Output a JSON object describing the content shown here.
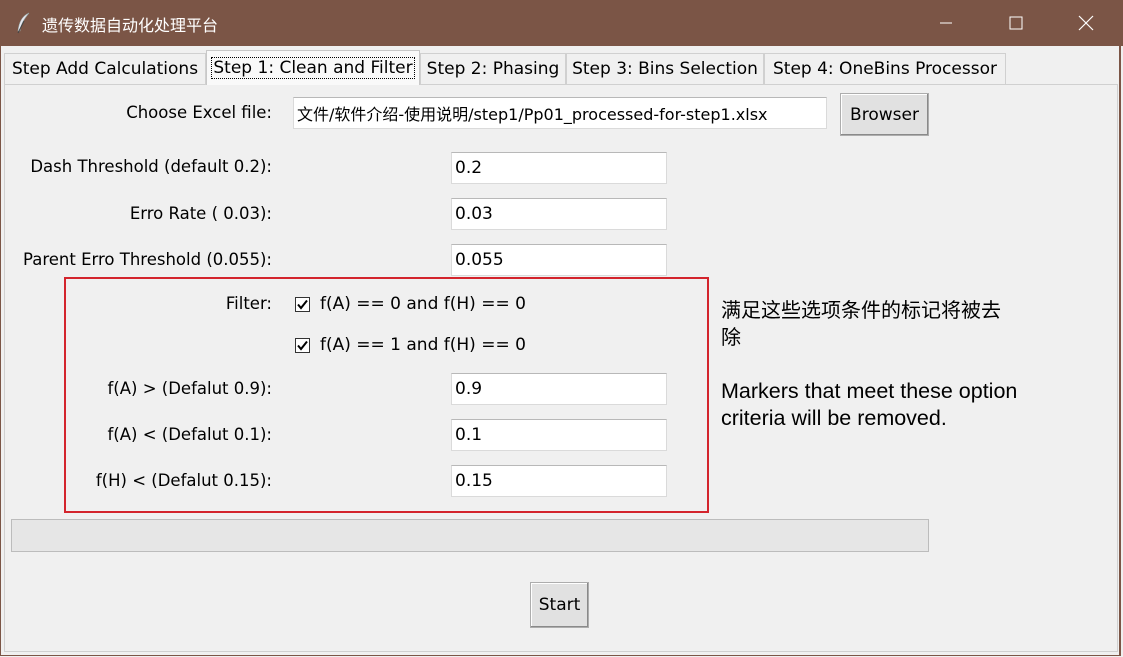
{
  "window": {
    "title": "遗传数据自动化处理平台",
    "icon": "feather-icon",
    "controls": [
      "minimize-icon",
      "maximize-icon",
      "close-icon"
    ]
  },
  "tabs": [
    {
      "label": "Step Add Calculations",
      "active": false
    },
    {
      "label": "Step 1: Clean and Filter",
      "active": true
    },
    {
      "label": "Step 2: Phasing",
      "active": false
    },
    {
      "label": "Step 3: Bins Selection",
      "active": false
    },
    {
      "label": "Step 4: OneBins Processor",
      "active": false
    }
  ],
  "file": {
    "label": "Choose Excel file:",
    "value": "文件/软件介绍-使用说明/step1/Pp01_processed-for-step1.xlsx",
    "browse_label": "Browser"
  },
  "fields": {
    "dash_threshold": {
      "label": "Dash Threshold (default 0.2):",
      "value": "0.2"
    },
    "erro_rate": {
      "label": "Erro Rate ( 0.03):",
      "value": "0.03"
    },
    "parent_erro": {
      "label": "Parent Erro Threshold (0.055):",
      "value": "0.055"
    },
    "fa_gt": {
      "label": "f(A) > (Defalut 0.9):",
      "value": "0.9"
    },
    "fa_lt": {
      "label": "f(A) < (Defalut 0.1):",
      "value": "0.1"
    },
    "fh_lt": {
      "label": "f(H) < (Defalut 0.15):",
      "value": "0.15"
    }
  },
  "filter": {
    "label": "Filter:",
    "options": [
      {
        "label": "f(A) == 0 and f(H) == 0",
        "checked": true
      },
      {
        "label": "f(A) == 1 and f(H) == 0",
        "checked": true
      }
    ]
  },
  "note": {
    "cn_line1": "满足这些选项条件的标记将被去",
    "cn_line2": "除",
    "en_line1": "Markers that meet these option",
    "en_line2": "criteria will be removed."
  },
  "progress": {
    "value": 0
  },
  "start_label": "Start",
  "colors": {
    "titlebar": "#7b5546",
    "highlight_box": "#d3242c",
    "background": "#f0f0f0"
  }
}
